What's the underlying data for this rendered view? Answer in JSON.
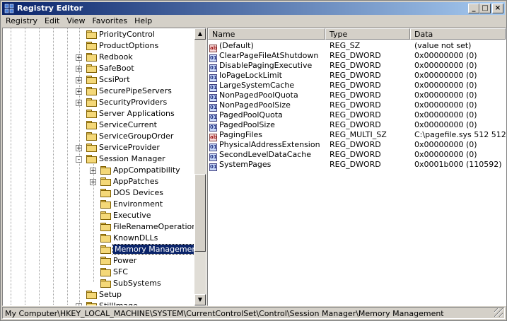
{
  "window": {
    "title": "Registry Editor"
  },
  "title_buttons": {
    "minimize": "_",
    "maximize": "□",
    "close": "×"
  },
  "menu": [
    "Registry",
    "Edit",
    "View",
    "Favorites",
    "Help"
  ],
  "tree": [
    {
      "label": "PriorityControl",
      "expander": ""
    },
    {
      "label": "ProductOptions",
      "expander": ""
    },
    {
      "label": "Redbook",
      "expander": "+"
    },
    {
      "label": "SafeBoot",
      "expander": "+"
    },
    {
      "label": "ScsiPort",
      "expander": "+"
    },
    {
      "label": "SecurePipeServers",
      "expander": "+"
    },
    {
      "label": "SecurityProviders",
      "expander": "+"
    },
    {
      "label": "Server Applications",
      "expander": ""
    },
    {
      "label": "ServiceCurrent",
      "expander": ""
    },
    {
      "label": "ServiceGroupOrder",
      "expander": ""
    },
    {
      "label": "ServiceProvider",
      "expander": "+"
    },
    {
      "label": "Session Manager",
      "expander": "-"
    },
    {
      "label": "AppCompatibility",
      "expander": "+"
    },
    {
      "label": "AppPatches",
      "expander": "+"
    },
    {
      "label": "DOS Devices",
      "expander": ""
    },
    {
      "label": "Environment",
      "expander": ""
    },
    {
      "label": "Executive",
      "expander": ""
    },
    {
      "label": "FileRenameOperations",
      "expander": ""
    },
    {
      "label": "KnownDLLs",
      "expander": ""
    },
    {
      "label": "Memory Management",
      "expander": "",
      "selected": true
    },
    {
      "label": "Power",
      "expander": ""
    },
    {
      "label": "SFC",
      "expander": ""
    },
    {
      "label": "SubSystems",
      "expander": ""
    },
    {
      "label": "Setup",
      "expander": ""
    },
    {
      "label": "StillImage",
      "expander": "+"
    }
  ],
  "list": {
    "headers": {
      "name": "Name",
      "type": "Type",
      "data": "Data"
    },
    "rows": [
      {
        "name": "(Default)",
        "type": "REG_SZ",
        "data": "(value not set)",
        "icon": "string"
      },
      {
        "name": "ClearPageFileAtShutdown",
        "type": "REG_DWORD",
        "data": "0x00000000 (0)",
        "icon": "binary"
      },
      {
        "name": "DisablePagingExecutive",
        "type": "REG_DWORD",
        "data": "0x00000000 (0)",
        "icon": "binary"
      },
      {
        "name": "IoPageLockLimit",
        "type": "REG_DWORD",
        "data": "0x00000000 (0)",
        "icon": "binary"
      },
      {
        "name": "LargeSystemCache",
        "type": "REG_DWORD",
        "data": "0x00000000 (0)",
        "icon": "binary"
      },
      {
        "name": "NonPagedPoolQuota",
        "type": "REG_DWORD",
        "data": "0x00000000 (0)",
        "icon": "binary"
      },
      {
        "name": "NonPagedPoolSize",
        "type": "REG_DWORD",
        "data": "0x00000000 (0)",
        "icon": "binary"
      },
      {
        "name": "PagedPoolQuota",
        "type": "REG_DWORD",
        "data": "0x00000000 (0)",
        "icon": "binary"
      },
      {
        "name": "PagedPoolSize",
        "type": "REG_DWORD",
        "data": "0x00000000 (0)",
        "icon": "binary"
      },
      {
        "name": "PagingFiles",
        "type": "REG_MULTI_SZ",
        "data": "C:\\pagefile.sys 512 512",
        "icon": "string"
      },
      {
        "name": "PhysicalAddressExtension",
        "type": "REG_DWORD",
        "data": "0x00000000 (0)",
        "icon": "binary"
      },
      {
        "name": "SecondLevelDataCache",
        "type": "REG_DWORD",
        "data": "0x00000000 (0)",
        "icon": "binary"
      },
      {
        "name": "SystemPages",
        "type": "REG_DWORD",
        "data": "0x0001b000 (110592)",
        "icon": "binary"
      }
    ]
  },
  "icon_text": {
    "string": "ab",
    "binary": "01"
  },
  "status": "My Computer\\HKEY_LOCAL_MACHINE\\SYSTEM\\CurrentControlSet\\Control\\Session Manager\\Memory Management"
}
